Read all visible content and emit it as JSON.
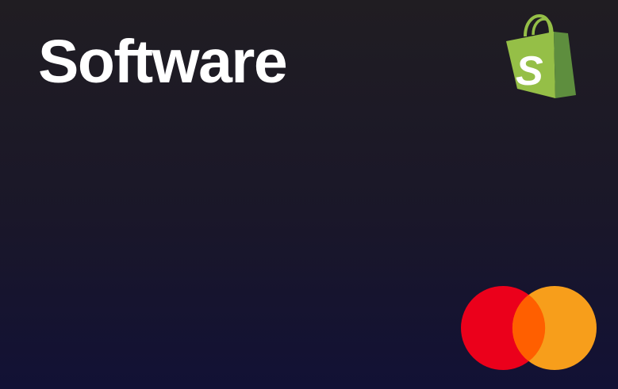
{
  "card": {
    "title": "Software",
    "brand_logo": "shopify-bag-logo",
    "brand_logo_letter": "S",
    "network_logo": "mastercard-logo"
  },
  "colors": {
    "bag_front": "#95bf47",
    "bag_side": "#5e8e3e",
    "mc_red": "#eb001b",
    "mc_orange": "#f79e1b",
    "mc_overlap": "#ff5f00"
  }
}
